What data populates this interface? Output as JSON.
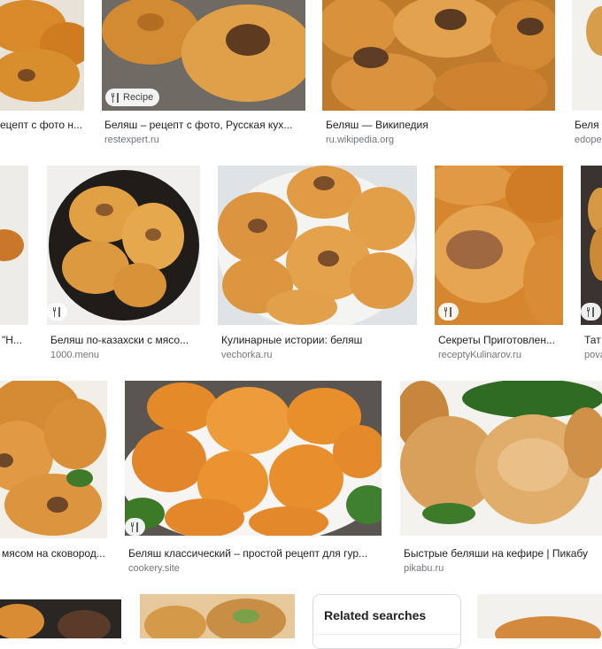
{
  "row1": [
    {
      "caption": "ецепт с фото н...",
      "source": ""
    },
    {
      "caption": "Беляш – рецепт с фото, Русская кух...",
      "source": "restexpert.ru",
      "badge": "Recipe"
    },
    {
      "caption": "Беляш — Википедия",
      "source": "ru.wikipedia.org"
    },
    {
      "caption": "Беля",
      "source": "edope"
    }
  ],
  "row2": [
    {
      "caption": "\"Н...",
      "source": ""
    },
    {
      "caption": "Беляш по-казахски с мясо...",
      "source": "1000.menu"
    },
    {
      "caption": "Кулинарные истории: беляш",
      "source": "vechorka.ru"
    },
    {
      "caption": "Секреты Приготовлен...",
      "source": "receptyKulinarov.ru"
    },
    {
      "caption": "Тат",
      "source": "pova"
    }
  ],
  "row3": [
    {
      "caption": "мясом на сковород...",
      "source": ""
    },
    {
      "caption": "Беляш классический – простой рецепт для гур...",
      "source": "cookery.site"
    },
    {
      "caption": "Быстрые беляши на кефире | Пикабу",
      "source": "pikabu.ru"
    }
  ],
  "related": {
    "title": "Related searches"
  },
  "icons": {
    "recipe_badge": "fork-knife-icon"
  },
  "colors": {
    "caption": "#202124",
    "source": "#70757a",
    "border": "#dadce0"
  }
}
